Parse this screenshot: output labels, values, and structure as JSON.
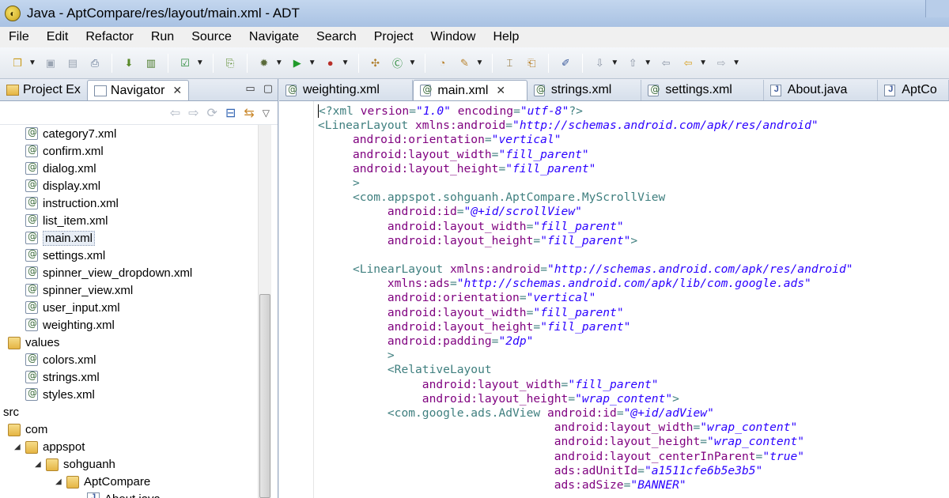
{
  "window": {
    "title": "Java - AptCompare/res/layout/main.xml - ADT"
  },
  "menu": [
    "File",
    "Edit",
    "Refactor",
    "Run",
    "Source",
    "Navigate",
    "Search",
    "Project",
    "Window",
    "Help"
  ],
  "left_panel": {
    "tabs": [
      {
        "label": "Project Ex",
        "active": false
      },
      {
        "label": "Navigator",
        "active": true
      }
    ],
    "tree": [
      {
        "label": "category7.xml",
        "type": "xml",
        "indent": 1
      },
      {
        "label": "confirm.xml",
        "type": "xml",
        "indent": 1
      },
      {
        "label": "dialog.xml",
        "type": "xml",
        "indent": 1
      },
      {
        "label": "display.xml",
        "type": "xml",
        "indent": 1
      },
      {
        "label": "instruction.xml",
        "type": "xml",
        "indent": 1
      },
      {
        "label": "list_item.xml",
        "type": "xml",
        "indent": 1
      },
      {
        "label": "main.xml",
        "type": "xml",
        "indent": 1,
        "selected": true
      },
      {
        "label": "settings.xml",
        "type": "xml",
        "indent": 1
      },
      {
        "label": "spinner_view_dropdown.xml",
        "type": "xml",
        "indent": 1
      },
      {
        "label": "spinner_view.xml",
        "type": "xml",
        "indent": 1
      },
      {
        "label": "user_input.xml",
        "type": "xml",
        "indent": 1
      },
      {
        "label": "weighting.xml",
        "type": "xml",
        "indent": 1
      },
      {
        "label": "values",
        "type": "folder",
        "indent": 0
      },
      {
        "label": "colors.xml",
        "type": "xml",
        "indent": 1
      },
      {
        "label": "strings.xml",
        "type": "xml",
        "indent": 1
      },
      {
        "label": "styles.xml",
        "type": "xml",
        "indent": 1
      },
      {
        "label": "src",
        "type": "none",
        "indent": -1
      },
      {
        "label": "com",
        "type": "folder",
        "indent": 0
      },
      {
        "label": "appspot",
        "type": "folder",
        "indent": 1,
        "expanded": true
      },
      {
        "label": "sohguanh",
        "type": "folder",
        "indent": 2,
        "expanded": true
      },
      {
        "label": "AptCompare",
        "type": "folder",
        "indent": 3,
        "expanded": true
      },
      {
        "label": "About.java",
        "type": "java",
        "indent": 4
      }
    ]
  },
  "editor": {
    "tabs": [
      {
        "label": "weighting.xml",
        "type": "xml",
        "active": false
      },
      {
        "label": "main.xml",
        "type": "xml",
        "active": true
      },
      {
        "label": "strings.xml",
        "type": "xml",
        "active": false
      },
      {
        "label": "settings.xml",
        "type": "xml",
        "active": false
      },
      {
        "label": "About.java",
        "type": "java",
        "active": false
      },
      {
        "label": "AptCo",
        "type": "java",
        "active": false
      }
    ],
    "lines": [
      {
        "indent": 0,
        "parts": [
          [
            "pi",
            "<?xml "
          ],
          [
            "attr",
            "version"
          ],
          [
            "pi",
            "="
          ],
          [
            "val",
            "\"1.0\""
          ],
          [
            "pi",
            " "
          ],
          [
            "attr",
            "encoding"
          ],
          [
            "pi",
            "="
          ],
          [
            "val",
            "\"utf-8\""
          ],
          [
            "pi",
            "?>"
          ]
        ]
      },
      {
        "indent": 0,
        "parts": [
          [
            "tag",
            "<LinearLayout "
          ],
          [
            "attr",
            "xmlns:android"
          ],
          [
            "tag",
            "="
          ],
          [
            "val",
            "\"http://schemas.android.com/apk/res/android\""
          ]
        ]
      },
      {
        "indent": 1,
        "parts": [
          [
            "attr",
            "android:orientation"
          ],
          [
            "tag",
            "="
          ],
          [
            "val",
            "\"vertical\""
          ]
        ]
      },
      {
        "indent": 1,
        "parts": [
          [
            "attr",
            "android:layout_width"
          ],
          [
            "tag",
            "="
          ],
          [
            "val",
            "\"fill_parent\""
          ]
        ]
      },
      {
        "indent": 1,
        "parts": [
          [
            "attr",
            "android:layout_height"
          ],
          [
            "tag",
            "="
          ],
          [
            "val",
            "\"fill_parent\""
          ]
        ]
      },
      {
        "indent": 1,
        "parts": [
          [
            "tag",
            ">"
          ]
        ]
      },
      {
        "indent": 1,
        "parts": [
          [
            "tag",
            "<com.appspot.sohguanh.AptCompare.MyScrollView"
          ]
        ]
      },
      {
        "indent": 2,
        "parts": [
          [
            "attr",
            "android:id"
          ],
          [
            "tag",
            "="
          ],
          [
            "val",
            "\"@+id/scrollView\""
          ]
        ]
      },
      {
        "indent": 2,
        "parts": [
          [
            "attr",
            "android:layout_width"
          ],
          [
            "tag",
            "="
          ],
          [
            "val",
            "\"fill_parent\""
          ]
        ]
      },
      {
        "indent": 2,
        "parts": [
          [
            "attr",
            "android:layout_height"
          ],
          [
            "tag",
            "="
          ],
          [
            "val",
            "\"fill_parent\""
          ],
          [
            "tag",
            ">"
          ]
        ]
      },
      {
        "indent": 0,
        "parts": []
      },
      {
        "indent": 1,
        "parts": [
          [
            "tag",
            "<LinearLayout "
          ],
          [
            "attr",
            "xmlns:android"
          ],
          [
            "tag",
            "="
          ],
          [
            "val",
            "\"http://schemas.android.com/apk/res/android\""
          ]
        ]
      },
      {
        "indent": 2,
        "parts": [
          [
            "attr",
            "xmlns:ads"
          ],
          [
            "tag",
            "="
          ],
          [
            "val",
            "\"http://schemas.android.com/apk/lib/com.google.ads\""
          ]
        ]
      },
      {
        "indent": 2,
        "parts": [
          [
            "attr",
            "android:orientation"
          ],
          [
            "tag",
            "="
          ],
          [
            "val",
            "\"vertical\""
          ]
        ]
      },
      {
        "indent": 2,
        "parts": [
          [
            "attr",
            "android:layout_width"
          ],
          [
            "tag",
            "="
          ],
          [
            "val",
            "\"fill_parent\""
          ]
        ]
      },
      {
        "indent": 2,
        "parts": [
          [
            "attr",
            "android:layout_height"
          ],
          [
            "tag",
            "="
          ],
          [
            "val",
            "\"fill_parent\""
          ]
        ]
      },
      {
        "indent": 2,
        "parts": [
          [
            "attr",
            "android:padding"
          ],
          [
            "tag",
            "="
          ],
          [
            "val",
            "\"2dp\""
          ]
        ]
      },
      {
        "indent": 2,
        "parts": [
          [
            "tag",
            ">"
          ]
        ]
      },
      {
        "indent": 2,
        "parts": [
          [
            "tag",
            "<RelativeLayout"
          ]
        ]
      },
      {
        "indent": 3,
        "parts": [
          [
            "attr",
            "android:layout_width"
          ],
          [
            "tag",
            "="
          ],
          [
            "val",
            "\"fill_parent\""
          ]
        ]
      },
      {
        "indent": 3,
        "parts": [
          [
            "attr",
            "android:layout_height"
          ],
          [
            "tag",
            "="
          ],
          [
            "val",
            "\"wrap_content\""
          ],
          [
            "tag",
            ">"
          ]
        ]
      },
      {
        "indent": 2,
        "parts": [
          [
            "tag",
            "<com.google.ads.AdView "
          ],
          [
            "attr",
            "android:id"
          ],
          [
            "tag",
            "="
          ],
          [
            "val",
            "\"@+id/adView\""
          ]
        ]
      },
      {
        "indent": 6,
        "parts": [
          [
            "attr",
            "android:layout_width"
          ],
          [
            "tag",
            "="
          ],
          [
            "val",
            "\"wrap_content\""
          ]
        ]
      },
      {
        "indent": 6,
        "parts": [
          [
            "attr",
            "android:layout_height"
          ],
          [
            "tag",
            "="
          ],
          [
            "val",
            "\"wrap_content\""
          ]
        ]
      },
      {
        "indent": 6,
        "parts": [
          [
            "attr",
            "android:layout_centerInParent"
          ],
          [
            "tag",
            "="
          ],
          [
            "val",
            "\"true\""
          ]
        ]
      },
      {
        "indent": 6,
        "parts": [
          [
            "attr",
            "ads:adUnitId"
          ],
          [
            "tag",
            "="
          ],
          [
            "val",
            "\"a1511cfe6b5e3b5\""
          ]
        ]
      },
      {
        "indent": 6,
        "parts": [
          [
            "attr",
            "ads:adSize"
          ],
          [
            "tag",
            "="
          ],
          [
            "val",
            "\"BANNER\""
          ]
        ]
      }
    ]
  },
  "colors": {
    "tag": "#3f7f7f",
    "attr": "#7f007f",
    "value": "#2a00ff"
  }
}
